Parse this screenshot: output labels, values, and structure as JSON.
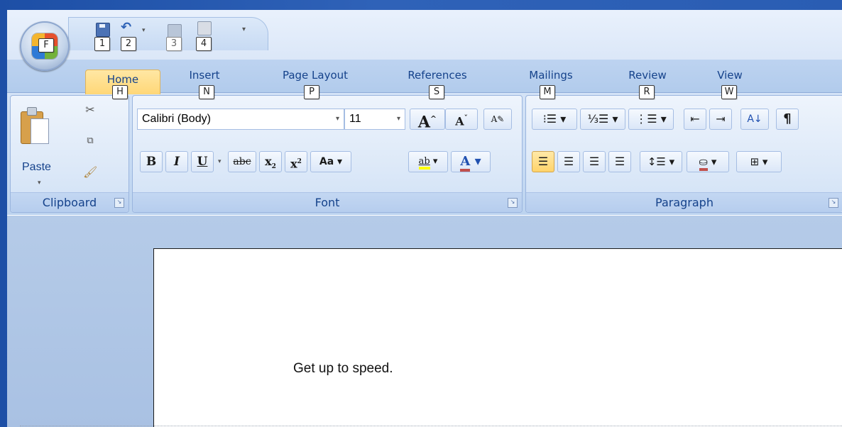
{
  "qat": {
    "office_button_keytip": "F",
    "keytips": [
      "1",
      "2",
      "3",
      "4"
    ]
  },
  "tabs": [
    {
      "label": "Home",
      "keytip": "H",
      "active": true
    },
    {
      "label": "Insert",
      "keytip": "N"
    },
    {
      "label": "Page Layout",
      "keytip": "P"
    },
    {
      "label": "References",
      "keytip": "S"
    },
    {
      "label": "Mailings",
      "keytip": "M"
    },
    {
      "label": "Review",
      "keytip": "R"
    },
    {
      "label": "View",
      "keytip": "W"
    }
  ],
  "clipboard": {
    "paste_label": "Paste",
    "group_label": "Clipboard"
  },
  "font": {
    "font_name": "Calibri (Body)",
    "font_size": "11",
    "grow_font": "A",
    "shrink_font": "A",
    "bold": "B",
    "italic": "I",
    "underline": "U",
    "strikethrough": "abc",
    "subscript": "x",
    "superscript": "x",
    "change_case": "Aa",
    "highlight": "ab",
    "font_color": "A",
    "group_label": "Font"
  },
  "paragraph": {
    "sort": "A↓",
    "pilcrow": "¶",
    "group_label": "Paragraph"
  },
  "document": {
    "body_text": "Get up to speed."
  },
  "colors": {
    "active_tab": "#ffd777",
    "ribbon_text": "#15428b",
    "highlight_yellow": "#ffff00",
    "font_red": "#c0504d"
  }
}
